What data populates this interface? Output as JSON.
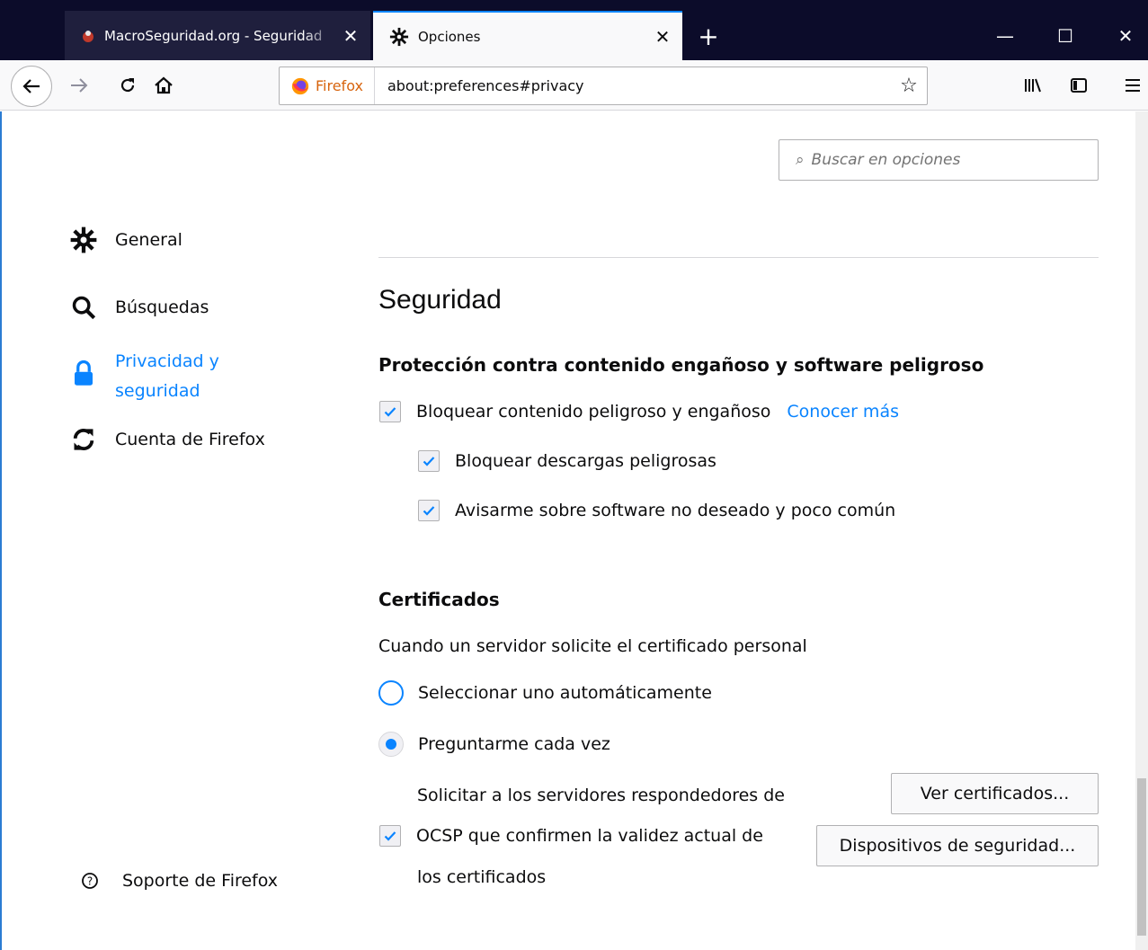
{
  "tabs": [
    {
      "title": "MacroSeguridad.org - Seguridad",
      "icon": "macroseguridad-favicon"
    },
    {
      "title": "Opciones",
      "icon": "gear-icon"
    }
  ],
  "new_tab_label": "+",
  "window_controls": {
    "minimize": "—",
    "maximize": "☐",
    "close": "✕"
  },
  "toolbar": {
    "identity_label": "Firefox",
    "url": "about:preferences#privacy"
  },
  "search": {
    "placeholder": "Buscar en opciones"
  },
  "sidebar": {
    "items": [
      {
        "label": "General",
        "icon": "gear-icon"
      },
      {
        "label": "Búsquedas",
        "icon": "search-icon"
      },
      {
        "label": "Privacidad y seguridad",
        "icon": "lock-icon",
        "selected": true
      },
      {
        "label": "Cuenta de Firefox",
        "icon": "sync-icon"
      }
    ],
    "support_label": "Soporte de Firefox"
  },
  "main": {
    "section_title": "Seguridad",
    "protection": {
      "heading": "Protección contra contenido engañoso y software peligroso",
      "block_dangerous": {
        "label": "Bloquear contenido peligroso y engañoso",
        "checked": true
      },
      "learn_more": "Conocer más",
      "block_downloads": {
        "label": "Bloquear descargas peligrosas",
        "checked": true
      },
      "warn_unwanted": {
        "label": "Avisarme sobre software no deseado y poco común",
        "checked": true
      }
    },
    "certificates": {
      "heading": "Certificados",
      "description": "Cuando un servidor solicite el certificado personal",
      "radio_auto": {
        "label": "Seleccionar uno automáticamente",
        "selected": false
      },
      "radio_ask": {
        "label": "Preguntarme cada vez",
        "selected": true
      },
      "ocsp_line1": "Solicitar a los servidores respondedores de",
      "ocsp_line2": "OCSP que confirmen la validez actual de",
      "ocsp_line3": "los certificados",
      "ocsp_checked": true,
      "view_certs_button": "Ver certificados...",
      "security_devices_button": "Dispositivos de seguridad..."
    }
  },
  "colors": {
    "accent": "#0a84ff",
    "tabbar": "#0c0c2a",
    "firefox_orange": "#d7640e"
  }
}
